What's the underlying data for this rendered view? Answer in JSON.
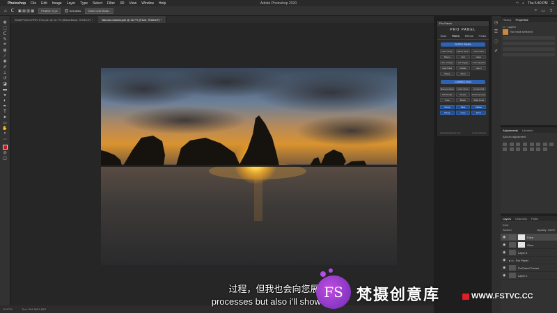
{
  "menubar": {
    "app": "Photoshop",
    "items": [
      "File",
      "Edit",
      "Image",
      "Layer",
      "Type",
      "Select",
      "Filter",
      "3D",
      "View",
      "Window",
      "Help"
    ],
    "window_title": "Adobe Photoshop 2020",
    "clock": "Thu 5:40 PM"
  },
  "optionsbar": {
    "feather": "Feather: 0 px",
    "anti_alias": "Anti-alias",
    "select_mask": "Select and Mask..."
  },
  "tabs": [
    "WhitePerfect-RRR-Trim.psb @ 16.7% (Black/Black, RGB/16*) *",
    "Bandon-tutorial.psb @ 16.7% (Flare, RGB/16*) *"
  ],
  "statusbar": {
    "zoom": "16.67%",
    "doc": "Doc: 264.3M/1.66G"
  },
  "propanel": {
    "header": "Pro Panel",
    "logo": "PRO PANEL",
    "tabs": [
      "Tools",
      "Filters",
      "Effects",
      "Finals"
    ],
    "sections": [
      "FILTER PANEL",
      "CORRECTION"
    ],
    "filter_buttons": [
      "Glow Sharp",
      "Blend Glow",
      "Ortan Glow",
      "Bloom",
      "Soft",
      "Haze",
      "Sat. Vintage",
      "Cat Toggle",
      "Cool Vignette",
      "High Pass",
      "Details",
      "Hue V",
      "Shake",
      "Wind"
    ],
    "correction_buttons": [
      "Remove Dust",
      "Color Chan",
      "Content Fill",
      "Soft Dodge",
      "Simple",
      "Reducing Layer",
      "Freq",
      "Blown",
      "Solid Lines"
    ],
    "blue_buttons": [
      "Group",
      "Save",
      "Flatten",
      "Merge",
      "Copy",
      "Move"
    ],
    "footer_left": "www.thepropanel.com",
    "footer_right": "Luxury Actions"
  },
  "properties": {
    "tabs": [
      "History",
      "Properties"
    ],
    "title": "Layers",
    "subtitle": "No mask selected"
  },
  "adjustments": {
    "tabs": [
      "Adjustments",
      "Libraries"
    ],
    "hint": "Add an adjustment"
  },
  "layers": {
    "tabs": [
      "Layers",
      "Channels",
      "Paths"
    ],
    "kind": "Kind",
    "blend": "Screen",
    "opacity": "Opacity: 100%",
    "rows": [
      "Flare",
      "Glow",
      "Layer 5",
      "Pro Panel",
      "ProPanel Curves",
      "Layer 2"
    ]
  },
  "overlay": {
    "subtitle_cn": "过程，但我也会向您展示",
    "subtitle_en": "processes but also i'll show you h",
    "brand_letter": "FS",
    "brand_cn": "梵摄创意库",
    "brand_url": "WWW.FSTVC.CC"
  }
}
